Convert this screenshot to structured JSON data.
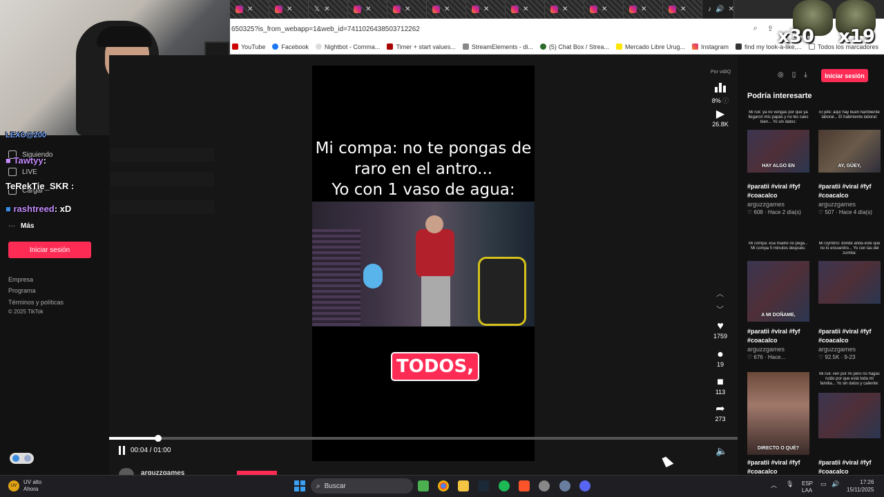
{
  "browser": {
    "tab_count": 13,
    "url": "650325?is_from_webapp=1&web_id=7411026438503712262",
    "bookmarks": [
      "YouTube",
      "Facebook",
      "Nightbot - Comma...",
      "Timer + start values...",
      "StreamElements - di...",
      "(5) Chat Box / Strea...",
      "Mercado Libre Urug...",
      "Instagram",
      "find my look-a-like,..."
    ],
    "all_bookmarks": "Todos los marcadores"
  },
  "overlay": {
    "emote1_label": "x30",
    "emote2_label": "x19",
    "chat": [
      {
        "user": "LEXO@200",
        "msg": "",
        "color": "#7aa7ff"
      },
      {
        "user": "Tawtyy",
        "msg": ":",
        "color": "#c58cff"
      },
      {
        "user": "TeRekTie_SKR",
        "msg": ":",
        "color": "#ffffff"
      },
      {
        "user": "rashtreed",
        "msg": ": xD",
        "color": "#c58cff"
      }
    ]
  },
  "sidebar": {
    "following": "Siguiendo",
    "live": "LIVE",
    "upload": "Cargar",
    "more": "Más",
    "login": "Iniciar sesión",
    "footer": [
      "Empresa",
      "Programa",
      "Términos y políticas",
      "© 2025 TikTok"
    ]
  },
  "video": {
    "caption_lines": [
      "Mi compa: no te pongas de",
      "raro en el antro...",
      "Yo con 1 vaso de agua:"
    ],
    "subtitle": "TODOS,",
    "time": "00:04 / 01:00",
    "progress_fraction": 0.0785,
    "author": "arguzzgames"
  },
  "actions": {
    "powered_by": "Por vidIQ",
    "score": "8%",
    "views": "26.8K",
    "likes": "1759",
    "comments": "19",
    "saves": "113",
    "shares": "273"
  },
  "right_panel": {
    "title": "Podría interesarte",
    "login": "Iniciar sesión",
    "cards": [
      {
        "top": "Mi ruk: ya no vengas por qué ya llegaron mis papás y no les caes bien... Yo sin datos:",
        "label": "HAY ALGO EN",
        "tags": "#paratii #viral #fyf #coacalco",
        "author": "arguzzgames",
        "meta": "608 · Hace 2 día(s)"
      },
      {
        "top": "El jefe: aquí hay buen hambiente laboral... El habmiente laboral:",
        "label": "AY, GÜEY,",
        "tags": "#paratii #viral #fyf #coacalco",
        "author": "arguzzgames",
        "meta": "507 · Hace 4 día(s)"
      },
      {
        "top": "Mi compa: esa madre no pega... Mi compa 5 minutos después:",
        "label": "A MI DOÑAME,",
        "tags": "#paratii #viral #fyf #coacalco",
        "author": "arguzzgames",
        "meta": "676 · Hace..."
      },
      {
        "top": "Mi Gymbro: donde anda este que no lo encuentro... Yo con las del zumba:",
        "label": "",
        "tags": "#paratii #viral #fyf #coacalco",
        "author": "arguzzgames",
        "meta": "92.5K · 9-23"
      },
      {
        "top": "",
        "label": "DIRECTO O QUÉ?",
        "tags": "#paratii #viral #fyf #coacalco",
        "author": "",
        "meta": ""
      },
      {
        "top": "Mi ruk: ven por mi pero no hagas ruido por que está toda mi familia... Yo sin datos y caliente:",
        "label": "",
        "tags": "#paratii #viral #fyf #coacalco",
        "author": "",
        "meta": ""
      }
    ]
  },
  "taskbar": {
    "weather_title": "UV alto",
    "weather_sub": "Ahora",
    "search": "Buscar",
    "lang": "ESP",
    "lang_sub": "LAA",
    "time": "17:26",
    "date": "15/11/2025"
  }
}
